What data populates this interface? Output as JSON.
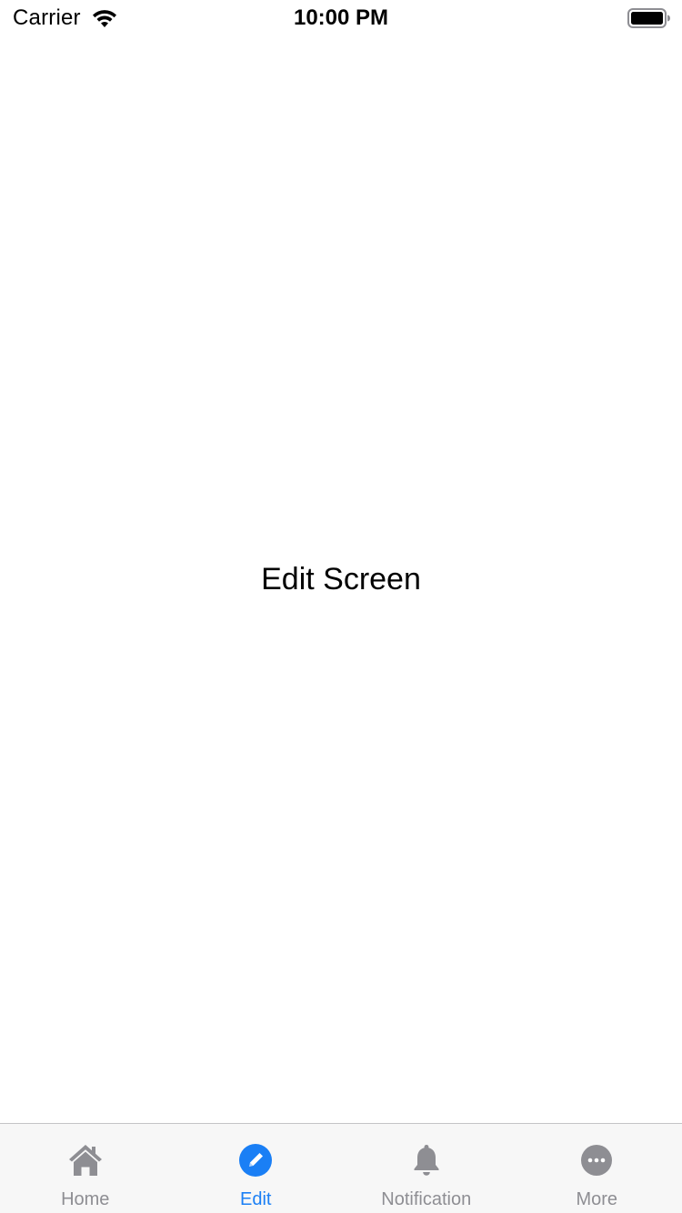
{
  "status_bar": {
    "carrier": "Carrier",
    "time": "10:00 PM",
    "wifi_icon": "wifi-icon",
    "battery_icon": "battery-full-icon"
  },
  "main": {
    "title": "Edit Screen"
  },
  "tab_bar": {
    "active_color": "#1a7ff5",
    "inactive_color": "#8e8e93",
    "tabs": [
      {
        "label": "Home",
        "icon": "home-icon",
        "active": false
      },
      {
        "label": "Edit",
        "icon": "edit-icon",
        "active": true
      },
      {
        "label": "Notification",
        "icon": "bell-icon",
        "active": false
      },
      {
        "label": "More",
        "icon": "more-icon",
        "active": false
      }
    ]
  }
}
